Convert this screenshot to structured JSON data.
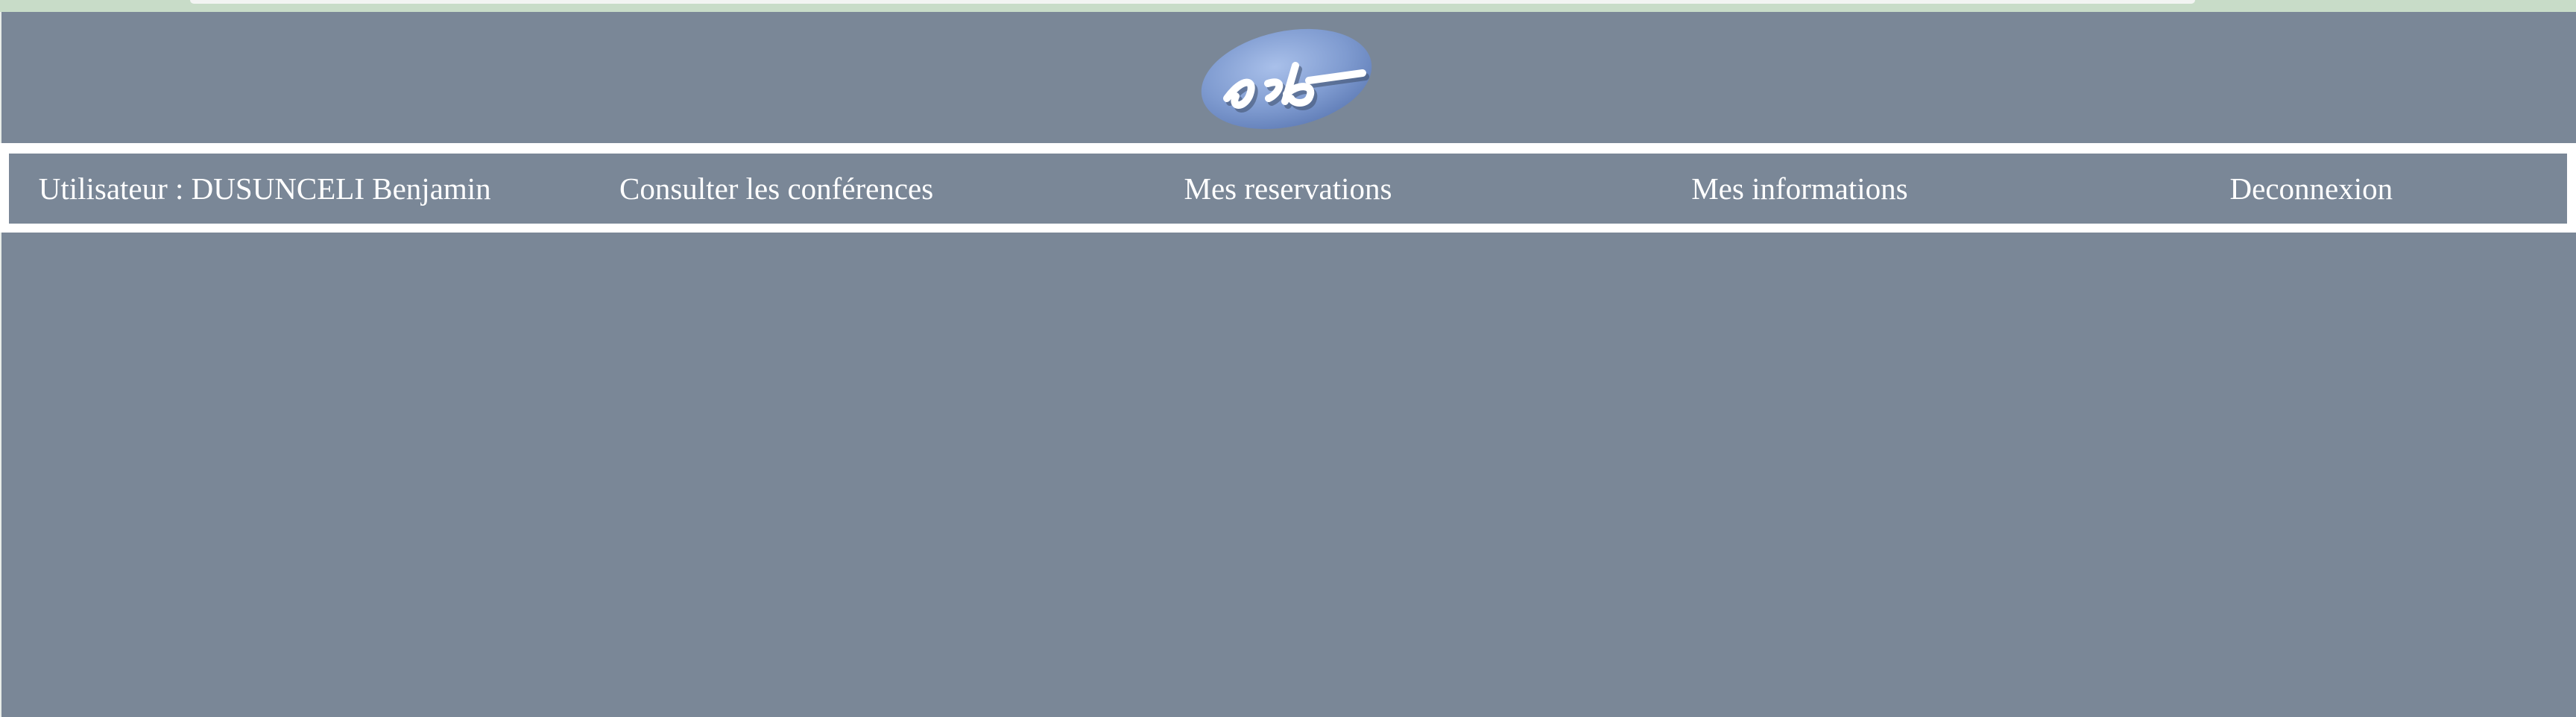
{
  "header": {
    "logo_text": "gsb"
  },
  "nav": {
    "user_label": "Utilisateur : DUSUNCELI Benjamin",
    "items": [
      {
        "label": "Consulter les conférences"
      },
      {
        "label": "Mes reservations"
      },
      {
        "label": "Mes informations"
      },
      {
        "label": "Deconnexion"
      }
    ]
  },
  "colors": {
    "background": "#7a8797",
    "nav_border": "#ffffff",
    "text": "#ffffff",
    "logo_oval": "#7f9bd0"
  }
}
